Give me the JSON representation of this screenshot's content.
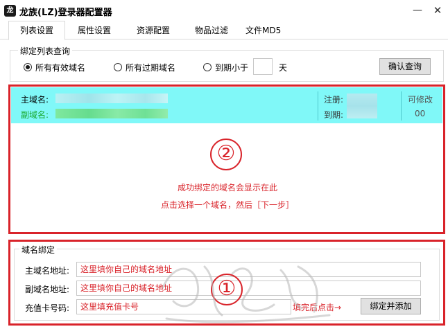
{
  "window": {
    "title": "龙族(LZ)登录器配置器",
    "icon_glyph": "龙",
    "minimize_glyph": "—",
    "close_glyph": "✕"
  },
  "tabs": [
    {
      "label": "列表设置",
      "active": true
    },
    {
      "label": "属性设置",
      "active": false
    },
    {
      "label": "资源配置",
      "active": false
    },
    {
      "label": "物品过滤",
      "active": false
    },
    {
      "label": "文件MD5",
      "active": false
    }
  ],
  "query": {
    "legend": "绑定列表查询",
    "options": [
      {
        "label": "所有有效域名",
        "checked": true
      },
      {
        "label": "所有过期域名",
        "checked": false
      },
      {
        "label": "到期小于",
        "checked": false
      }
    ],
    "days_value": "",
    "days_unit": "天",
    "confirm_button": "确认查询"
  },
  "domain_list": {
    "item": {
      "main_label": "主域名:",
      "sub_label": "副域名:",
      "reg_label": "注册:",
      "exp_label": "到期:",
      "modify_label": "可修改",
      "count": "00"
    }
  },
  "annotations": {
    "circle_two": "②",
    "circle_one": "①",
    "list_line1": "成功绑定的域名会显示在此",
    "list_line2": "点击选择一个域名，然后［下一步］",
    "fill_hint": "填完后点击→"
  },
  "binding": {
    "legend": "域名绑定",
    "main_label": "主域名地址:",
    "main_value": "这里填你自己的域名地址",
    "sub_label": "副域名地址:",
    "sub_value": "这里填你自己的域名地址",
    "card_label": "充值卡号码:",
    "card_value": "这里填充值卡号",
    "bind_button": "绑定并添加"
  },
  "colors": {
    "annotation_red": "#d9232a",
    "list_highlight": "#80f8f8",
    "sub_domain_green": "#16a82a"
  }
}
